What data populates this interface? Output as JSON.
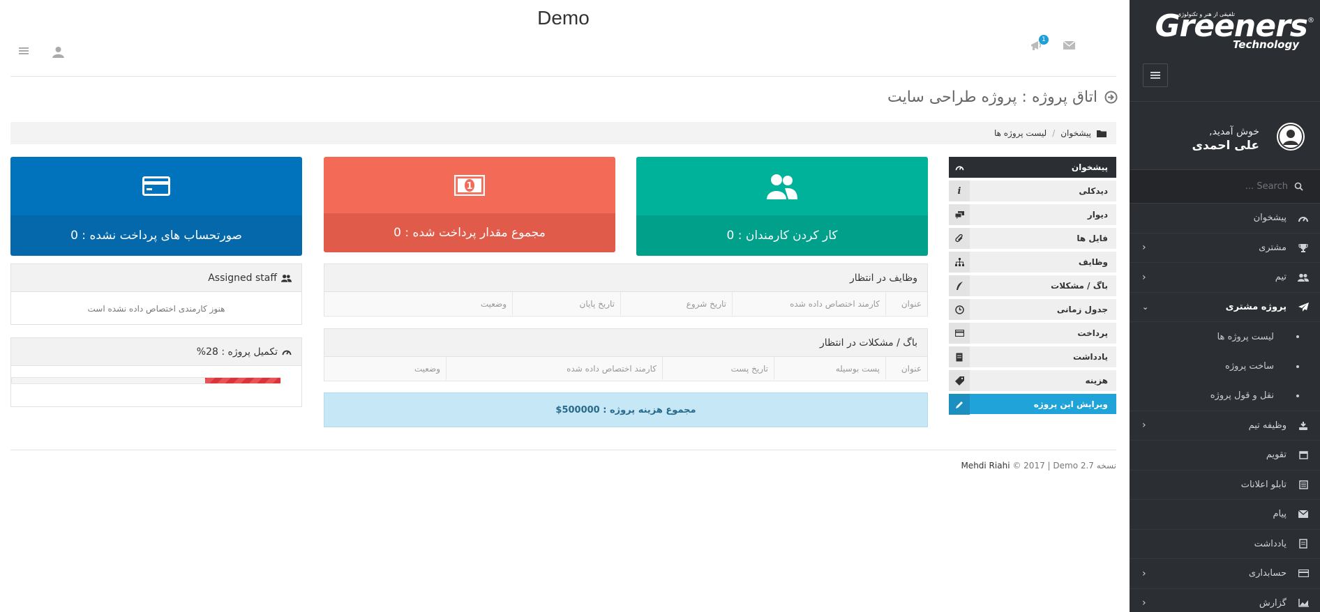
{
  "header": {
    "site_title": "Demo",
    "notification_count": "1"
  },
  "sidebar": {
    "logo": {
      "main": "Greeners",
      "sub": "Technology",
      "tagline": "تلفیقی از هنر و تکنولوژی",
      "reg": "®"
    },
    "welcome": "خوش آمدید,",
    "username": "علی احمدی",
    "search_placeholder": "Search ...",
    "menu": [
      {
        "label": "پیشخوان",
        "icon": "dashboard-icon"
      },
      {
        "label": "مشتری",
        "icon": "trophy-icon"
      },
      {
        "label": "تیم",
        "icon": "users-icon"
      },
      {
        "label": "پروژه مشتری",
        "icon": "paper-plane-icon"
      },
      {
        "label": "لیست پروژه ها"
      },
      {
        "label": "ساخت پروژه"
      },
      {
        "label": "نقل و قول پروژه"
      },
      {
        "label": "وظیفه تیم",
        "icon": "task-icon"
      },
      {
        "label": "تقویم",
        "icon": "calendar-icon"
      },
      {
        "label": "تابلو اعلانات",
        "icon": "board-icon"
      },
      {
        "label": "پیام",
        "icon": "mail-icon"
      },
      {
        "label": "یادداشت",
        "icon": "note-icon"
      },
      {
        "label": "حسابداری",
        "icon": "credit-card-icon"
      },
      {
        "label": "گزارش",
        "icon": "chart-icon"
      }
    ]
  },
  "page": {
    "title": "اتاق پروژه : پروژه طراحی سایت",
    "breadcrumb": [
      "پیشخوان",
      "/",
      "لیست پروژه ها"
    ]
  },
  "project_menu": [
    {
      "label": "پیشخوان",
      "icon": "dashboard-icon"
    },
    {
      "label": "دیدکلی",
      "icon": "info-icon"
    },
    {
      "label": "دیوار",
      "icon": "comments-icon"
    },
    {
      "label": "فایل ها",
      "icon": "paperclip-icon"
    },
    {
      "label": "وظایف",
      "icon": "sitemap-icon"
    },
    {
      "label": "باگ / مشکلات",
      "icon": "bug-icon"
    },
    {
      "label": "جدول زمانی",
      "icon": "clock-icon"
    },
    {
      "label": "پرداخت",
      "icon": "card-icon"
    },
    {
      "label": "یادداشت",
      "icon": "note-icon"
    },
    {
      "label": "هزینه",
      "icon": "tag-icon"
    },
    {
      "label": "ویرایش این پروژه",
      "icon": "pencil-icon"
    }
  ],
  "cards": {
    "staff": "کار کردن کارمندان : 0",
    "paid": "مجموع مقدار پرداخت شده : 0",
    "unpaid": "صورتحساب های پرداخت نشده : 0"
  },
  "tasks": {
    "title": "وظایف در انتظار",
    "columns": [
      "عنوان",
      "کارمند اختصاص داده شده",
      "تاریخ شروع",
      "تاریخ پایان",
      "وضعیت"
    ]
  },
  "bugs": {
    "title": "باگ / مشکلات در انتظار",
    "columns": [
      "عنوان",
      "پست بوسیله",
      "تاریخ پست",
      "کارمند اختصاص داده شده",
      "وضعیت"
    ]
  },
  "cost": "مجموع هزینه پروژه : 500000$",
  "assigned": {
    "title": "Assigned staff",
    "empty": "هنوز کارمندی اختصاص داده نشده است"
  },
  "completion": {
    "title": "تکمیل پروژه : 28%",
    "percent": 28
  },
  "footer": {
    "text": "© 2017 | Demo نسخه 2.7",
    "author": "Mehdi Riahi"
  }
}
